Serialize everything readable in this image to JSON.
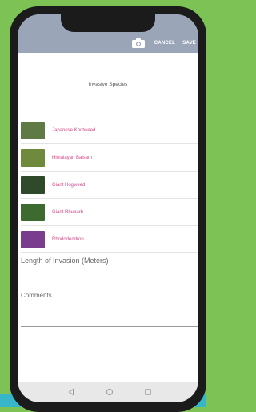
{
  "appbar": {
    "cancel_label": "CANCEL",
    "save_label": "SAVE",
    "camera_icon": "camera-icon"
  },
  "section_title": "Invasive Species",
  "species": [
    {
      "name": "Japanese Knotweed",
      "thumb_color": "#5f7a45"
    },
    {
      "name": "Himalayan Balsam",
      "thumb_color": "#6f8a3d"
    },
    {
      "name": "Giant Hogweed",
      "thumb_color": "#2f4a2a"
    },
    {
      "name": "Giant Rhubarb",
      "thumb_color": "#3d6b2f"
    },
    {
      "name": "Rhododendron",
      "thumb_color": "#7a3c8c"
    }
  ],
  "length_label": "Length of Invasion (Meters)",
  "comments_label": "Comments",
  "colors": {
    "appbar": "#9aa5b8",
    "species_text": "#d44a8c",
    "background_green": "#7cc255",
    "background_blue": "#37b6c9"
  },
  "navbar_icons": [
    "back-icon",
    "home-icon",
    "recent-apps-icon"
  ]
}
